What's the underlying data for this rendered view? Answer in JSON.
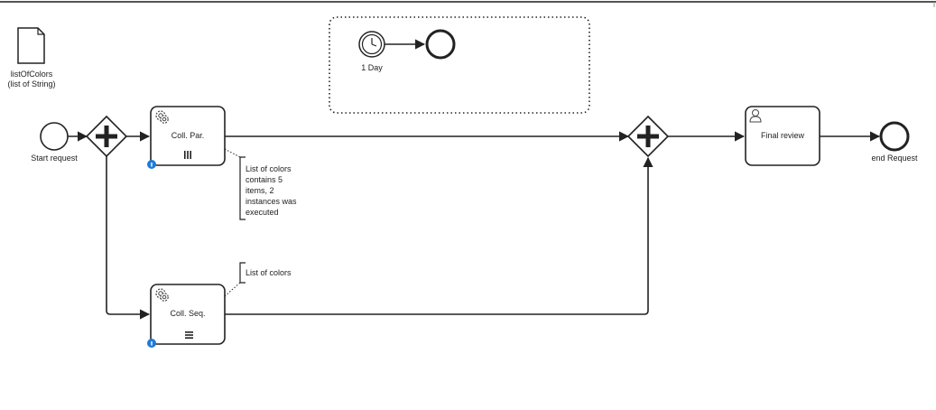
{
  "data_object": {
    "line1": "listOfColors",
    "line2": "(list of String)"
  },
  "timer": {
    "label": "1 Day"
  },
  "events": {
    "start_label": "Start request",
    "end_label": "end Request"
  },
  "tasks": {
    "parallel": {
      "label": "Coll. Par.",
      "marker": "|||"
    },
    "sequential": {
      "label": "Coll. Seq.",
      "marker": "≡"
    },
    "review": {
      "label": "Final review"
    }
  },
  "annotations": {
    "parallel_note": [
      "List of colors",
      "contains 5",
      "items, 2",
      "instances was",
      "executed"
    ],
    "sequential_note": "List of colors"
  },
  "colors": {
    "stroke": "#222222",
    "badge": "#1f7bd6"
  },
  "icons": {
    "data_object": "document-icon",
    "timer": "clock-icon",
    "service_task": "gears-icon",
    "user_task": "user-icon",
    "gateway": "parallel-gateway-plus-icon",
    "badge": "info-badge-icon"
  }
}
